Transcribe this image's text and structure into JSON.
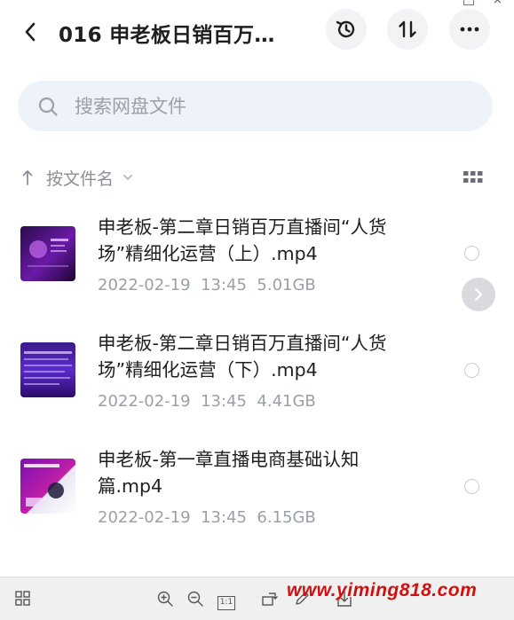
{
  "header": {
    "title": "016 申老板日销百万…"
  },
  "search": {
    "placeholder": "搜索网盘文件"
  },
  "sort": {
    "label": "按文件名"
  },
  "files": [
    {
      "name": "申老板-第二章日销百万直播间“人货场”精细化运营（上）.mp4",
      "name_line1": "申老板-第二章日销百万直播间“人货",
      "name_line2": "场”精细化运营（上）.mp4",
      "date": "2022-02-19",
      "time": "13:45",
      "size": "5.01GB"
    },
    {
      "name": "申老板-第二章日销百万直播间“人货场”精细化运营（下）.mp4",
      "name_line1": "申老板-第二章日销百万直播间“人货",
      "name_line2": "场”精细化运营（下）.mp4",
      "date": "2022-02-19",
      "time": "13:45",
      "size": "4.41GB"
    },
    {
      "name": "申老板-第一章直播电商基础认知篇.mp4",
      "name_line1": "申老板-第一章直播电商基础认知",
      "name_line2": "篇.mp4",
      "date": "2022-02-19",
      "time": "13:45",
      "size": "6.15GB"
    }
  ],
  "toolbar": {
    "actual_size_label": "1:1"
  },
  "watermark": "www.yiming818.com",
  "colors": {
    "accent_red": "#d20f0f",
    "search_bg": "#eef3fa",
    "muted_text": "#9aa0a8"
  }
}
